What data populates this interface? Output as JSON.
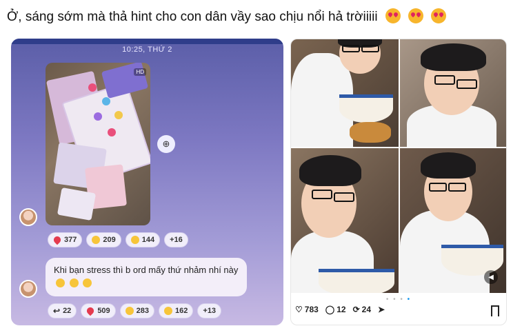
{
  "post": {
    "caption": "Ở, sáng sớm mà thả hint cho con dân vầy sao chịu nổi hả trờiiiii",
    "caption_emojis": [
      "heart-eyes-emoji",
      "heart-eyes-emoji",
      "heart-eyes-emoji"
    ]
  },
  "left_screenshot": {
    "timestamp": "10:25, THỨ 2",
    "image_badge": "HD",
    "reactions_top": [
      {
        "icon": "heart",
        "count": "377"
      },
      {
        "icon": "laugh",
        "count": "209"
      },
      {
        "icon": "grin",
        "count": "144"
      },
      {
        "icon": "",
        "count": "+16"
      }
    ],
    "message": "Khi bạn stress thì b ord mấy thứ nhảm nhí này",
    "message_emojis": [
      "smile-emoji",
      "smile-emoji",
      "smile-emoji"
    ],
    "reactions_bottom": [
      {
        "icon": "reply",
        "count": "22"
      },
      {
        "icon": "heart",
        "count": "509"
      },
      {
        "icon": "grin",
        "count": "283"
      },
      {
        "icon": "laugh",
        "count": "162"
      },
      {
        "icon": "",
        "count": "+13"
      }
    ]
  },
  "right_post": {
    "likes": "783",
    "replies": "12",
    "reposts": "24",
    "carousel_dots": 4,
    "active_dot": 4
  },
  "colors": {
    "left_bg_top": "#5b5ea8",
    "left_bg_bottom": "#c7b9e3",
    "heart": "#e43b4f",
    "emoji": "#f7b52c"
  }
}
